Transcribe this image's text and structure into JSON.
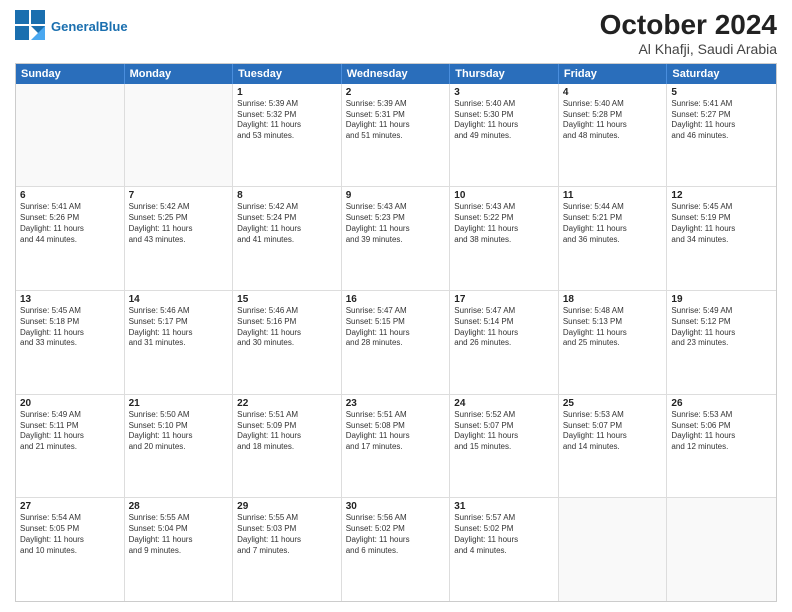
{
  "logo": {
    "text_general": "General",
    "text_blue": "Blue"
  },
  "title": "October 2024",
  "subtitle": "Al Khafji, Saudi Arabia",
  "header": {
    "days": [
      "Sunday",
      "Monday",
      "Tuesday",
      "Wednesday",
      "Thursday",
      "Friday",
      "Saturday"
    ]
  },
  "rows": [
    [
      {
        "day": "",
        "lines": []
      },
      {
        "day": "",
        "lines": []
      },
      {
        "day": "1",
        "lines": [
          "Sunrise: 5:39 AM",
          "Sunset: 5:32 PM",
          "Daylight: 11 hours",
          "and 53 minutes."
        ]
      },
      {
        "day": "2",
        "lines": [
          "Sunrise: 5:39 AM",
          "Sunset: 5:31 PM",
          "Daylight: 11 hours",
          "and 51 minutes."
        ]
      },
      {
        "day": "3",
        "lines": [
          "Sunrise: 5:40 AM",
          "Sunset: 5:30 PM",
          "Daylight: 11 hours",
          "and 49 minutes."
        ]
      },
      {
        "day": "4",
        "lines": [
          "Sunrise: 5:40 AM",
          "Sunset: 5:28 PM",
          "Daylight: 11 hours",
          "and 48 minutes."
        ]
      },
      {
        "day": "5",
        "lines": [
          "Sunrise: 5:41 AM",
          "Sunset: 5:27 PM",
          "Daylight: 11 hours",
          "and 46 minutes."
        ]
      }
    ],
    [
      {
        "day": "6",
        "lines": [
          "Sunrise: 5:41 AM",
          "Sunset: 5:26 PM",
          "Daylight: 11 hours",
          "and 44 minutes."
        ]
      },
      {
        "day": "7",
        "lines": [
          "Sunrise: 5:42 AM",
          "Sunset: 5:25 PM",
          "Daylight: 11 hours",
          "and 43 minutes."
        ]
      },
      {
        "day": "8",
        "lines": [
          "Sunrise: 5:42 AM",
          "Sunset: 5:24 PM",
          "Daylight: 11 hours",
          "and 41 minutes."
        ]
      },
      {
        "day": "9",
        "lines": [
          "Sunrise: 5:43 AM",
          "Sunset: 5:23 PM",
          "Daylight: 11 hours",
          "and 39 minutes."
        ]
      },
      {
        "day": "10",
        "lines": [
          "Sunrise: 5:43 AM",
          "Sunset: 5:22 PM",
          "Daylight: 11 hours",
          "and 38 minutes."
        ]
      },
      {
        "day": "11",
        "lines": [
          "Sunrise: 5:44 AM",
          "Sunset: 5:21 PM",
          "Daylight: 11 hours",
          "and 36 minutes."
        ]
      },
      {
        "day": "12",
        "lines": [
          "Sunrise: 5:45 AM",
          "Sunset: 5:19 PM",
          "Daylight: 11 hours",
          "and 34 minutes."
        ]
      }
    ],
    [
      {
        "day": "13",
        "lines": [
          "Sunrise: 5:45 AM",
          "Sunset: 5:18 PM",
          "Daylight: 11 hours",
          "and 33 minutes."
        ]
      },
      {
        "day": "14",
        "lines": [
          "Sunrise: 5:46 AM",
          "Sunset: 5:17 PM",
          "Daylight: 11 hours",
          "and 31 minutes."
        ]
      },
      {
        "day": "15",
        "lines": [
          "Sunrise: 5:46 AM",
          "Sunset: 5:16 PM",
          "Daylight: 11 hours",
          "and 30 minutes."
        ]
      },
      {
        "day": "16",
        "lines": [
          "Sunrise: 5:47 AM",
          "Sunset: 5:15 PM",
          "Daylight: 11 hours",
          "and 28 minutes."
        ]
      },
      {
        "day": "17",
        "lines": [
          "Sunrise: 5:47 AM",
          "Sunset: 5:14 PM",
          "Daylight: 11 hours",
          "and 26 minutes."
        ]
      },
      {
        "day": "18",
        "lines": [
          "Sunrise: 5:48 AM",
          "Sunset: 5:13 PM",
          "Daylight: 11 hours",
          "and 25 minutes."
        ]
      },
      {
        "day": "19",
        "lines": [
          "Sunrise: 5:49 AM",
          "Sunset: 5:12 PM",
          "Daylight: 11 hours",
          "and 23 minutes."
        ]
      }
    ],
    [
      {
        "day": "20",
        "lines": [
          "Sunrise: 5:49 AM",
          "Sunset: 5:11 PM",
          "Daylight: 11 hours",
          "and 21 minutes."
        ]
      },
      {
        "day": "21",
        "lines": [
          "Sunrise: 5:50 AM",
          "Sunset: 5:10 PM",
          "Daylight: 11 hours",
          "and 20 minutes."
        ]
      },
      {
        "day": "22",
        "lines": [
          "Sunrise: 5:51 AM",
          "Sunset: 5:09 PM",
          "Daylight: 11 hours",
          "and 18 minutes."
        ]
      },
      {
        "day": "23",
        "lines": [
          "Sunrise: 5:51 AM",
          "Sunset: 5:08 PM",
          "Daylight: 11 hours",
          "and 17 minutes."
        ]
      },
      {
        "day": "24",
        "lines": [
          "Sunrise: 5:52 AM",
          "Sunset: 5:07 PM",
          "Daylight: 11 hours",
          "and 15 minutes."
        ]
      },
      {
        "day": "25",
        "lines": [
          "Sunrise: 5:53 AM",
          "Sunset: 5:07 PM",
          "Daylight: 11 hours",
          "and 14 minutes."
        ]
      },
      {
        "day": "26",
        "lines": [
          "Sunrise: 5:53 AM",
          "Sunset: 5:06 PM",
          "Daylight: 11 hours",
          "and 12 minutes."
        ]
      }
    ],
    [
      {
        "day": "27",
        "lines": [
          "Sunrise: 5:54 AM",
          "Sunset: 5:05 PM",
          "Daylight: 11 hours",
          "and 10 minutes."
        ]
      },
      {
        "day": "28",
        "lines": [
          "Sunrise: 5:55 AM",
          "Sunset: 5:04 PM",
          "Daylight: 11 hours",
          "and 9 minutes."
        ]
      },
      {
        "day": "29",
        "lines": [
          "Sunrise: 5:55 AM",
          "Sunset: 5:03 PM",
          "Daylight: 11 hours",
          "and 7 minutes."
        ]
      },
      {
        "day": "30",
        "lines": [
          "Sunrise: 5:56 AM",
          "Sunset: 5:02 PM",
          "Daylight: 11 hours",
          "and 6 minutes."
        ]
      },
      {
        "day": "31",
        "lines": [
          "Sunrise: 5:57 AM",
          "Sunset: 5:02 PM",
          "Daylight: 11 hours",
          "and 4 minutes."
        ]
      },
      {
        "day": "",
        "lines": []
      },
      {
        "day": "",
        "lines": []
      }
    ]
  ]
}
